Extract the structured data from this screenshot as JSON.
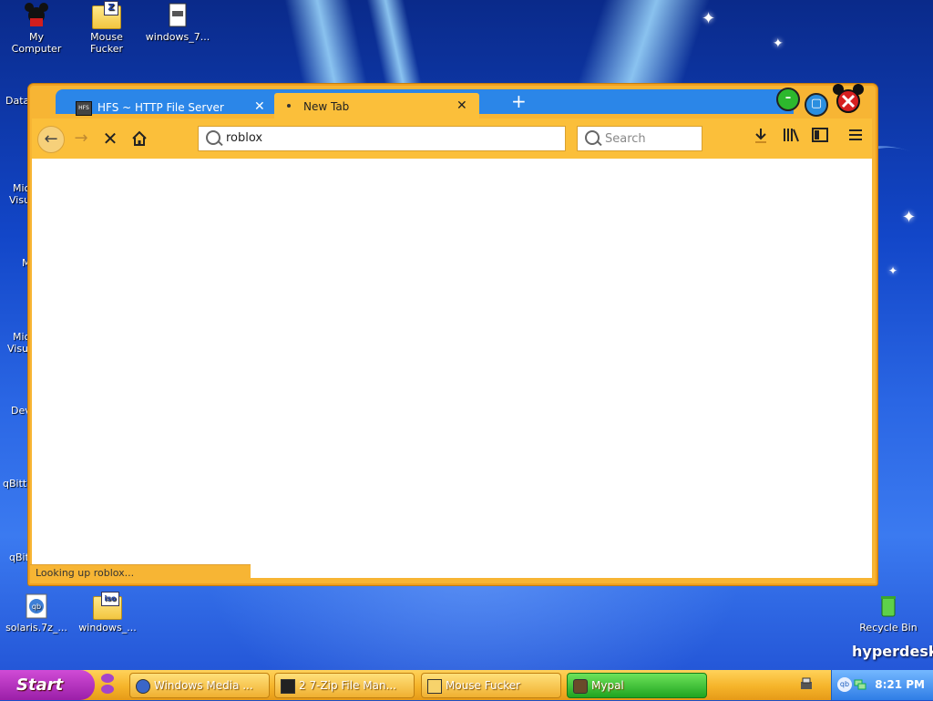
{
  "desktop": {
    "icons": [
      {
        "label_line1": "My",
        "label_line2": "Computer"
      },
      {
        "label_line1": "Mouse",
        "label_line2": "Fucker"
      },
      {
        "label_line1": "windows_7...",
        "label_line2": ""
      },
      {
        "label_line1": "solaris.7z_...",
        "label_line2": ""
      },
      {
        "label_line1": "windows_...",
        "label_line2": ""
      },
      {
        "label_line1": "Recycle Bin",
        "label_line2": ""
      }
    ],
    "edge_labels": [
      "Data",
      "Mic",
      "Visu",
      "M",
      "Mic",
      "Visu",
      "Dev",
      "qBitt",
      "qBit"
    ],
    "folder_tags": [
      "Z",
      "iso"
    ],
    "brand": "hyperdesk"
  },
  "browser": {
    "tabs": [
      {
        "title": "HFS ~ HTTP File Server",
        "icon": "hfs-icon",
        "icon_text": "HFS"
      },
      {
        "title": "New Tab",
        "icon": "loading-dot-icon"
      }
    ],
    "new_tab_glyph": "+",
    "url_value": "roblox",
    "search_placeholder": "Search",
    "status_text": "Looking up roblox..."
  },
  "taskbar": {
    "start_label": "Start",
    "tasks": [
      {
        "label": "Windows Media ..."
      },
      {
        "label": "2 7-Zip File Man..."
      },
      {
        "label": "Mouse Fucker"
      },
      {
        "label": "Mypal"
      }
    ],
    "clock": "8:21 PM",
    "tray_badge": "qb"
  },
  "colors": {
    "window_frame": "#f7b534",
    "tabstrip": "#2b86e8",
    "taskbar": "#f5b42a",
    "start_button": "#b52ec0",
    "active_task": "#2fb62a"
  }
}
